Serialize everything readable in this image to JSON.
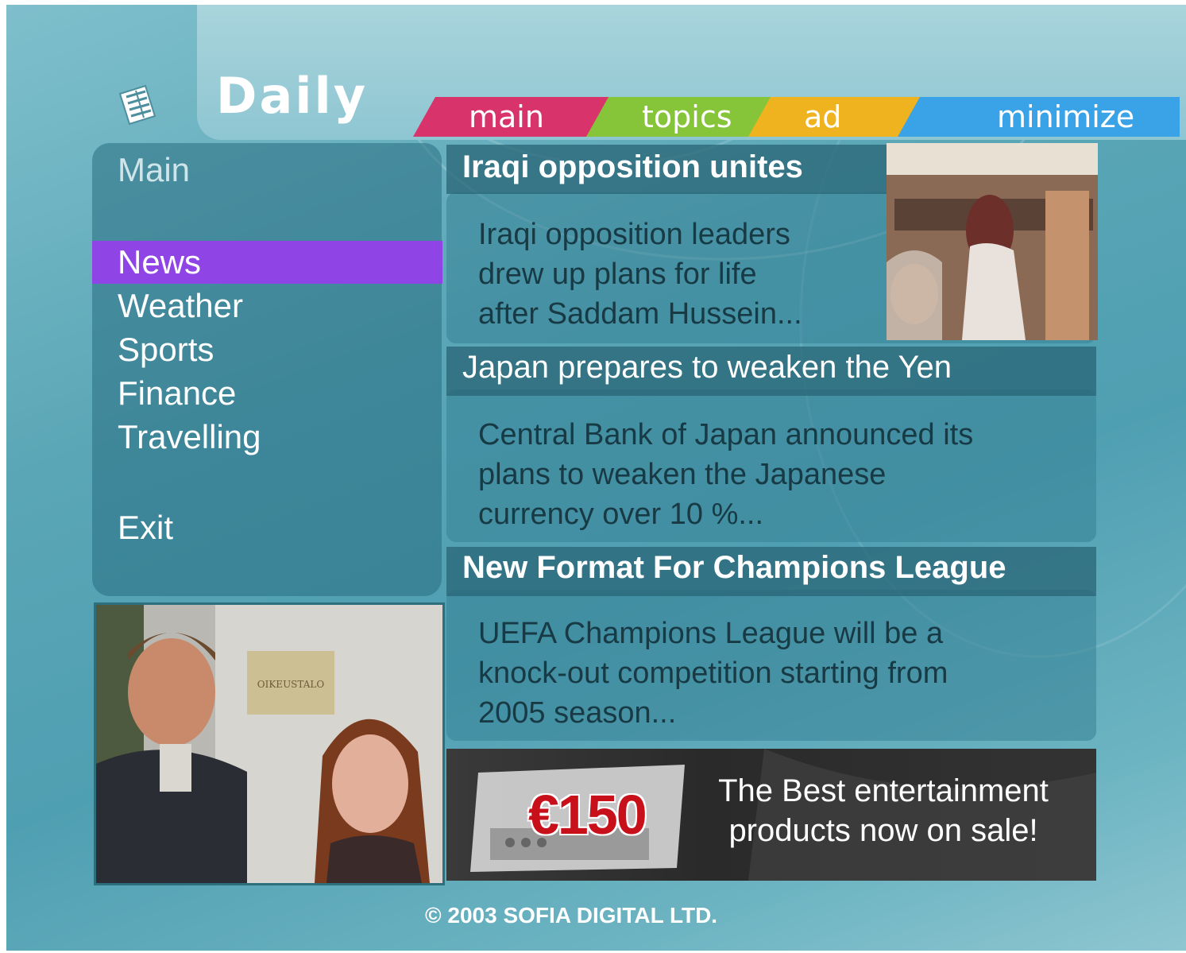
{
  "app": {
    "title": "Daily"
  },
  "tabs": [
    {
      "label": "main",
      "color": "#d8336a"
    },
    {
      "label": "topics",
      "color": "#86c43a"
    },
    {
      "label": "ad",
      "color": "#f0b320"
    },
    {
      "label": "minimize",
      "color": "#3aa2e6"
    }
  ],
  "menu": {
    "title": "Main",
    "items": [
      {
        "label": "News",
        "active": true
      },
      {
        "label": "Weather",
        "active": false
      },
      {
        "label": "Sports",
        "active": false
      },
      {
        "label": "Finance",
        "active": false
      },
      {
        "label": "Travelling",
        "active": false
      }
    ],
    "exit_label": "Exit",
    "active_color": "#8f45e6"
  },
  "video": {
    "sign_text": "OIKEUSTALO"
  },
  "stories": [
    {
      "headline": "Iraqi opposition unites",
      "summary": "Iraqi opposition leaders\ndrew up plans for life\nafter Saddam Hussein..."
    },
    {
      "headline": "Japan prepares to weaken the Yen",
      "summary": "Central Bank of Japan announced its\nplans to weaken the Japanese\ncurrency over 10 %..."
    },
    {
      "headline": "New Format For Champions League",
      "summary": "UEFA Champions League will be a\nknock-out competition starting from\n2005 season..."
    }
  ],
  "ad": {
    "price": "€150",
    "text": "The Best entertainment\nproducts now on sale!"
  },
  "footer": {
    "copyright": "© 2003 SOFIA DIGITAL LTD."
  }
}
